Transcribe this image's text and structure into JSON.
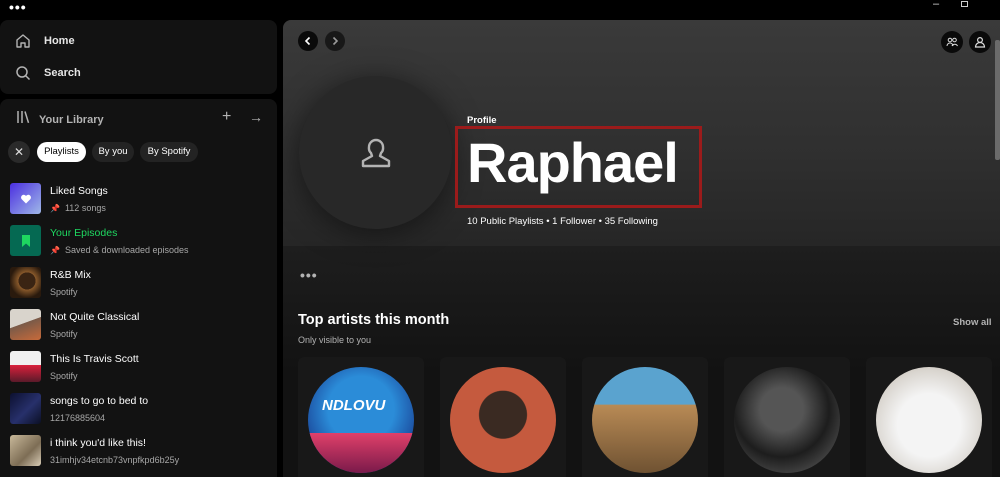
{
  "titlebar": {
    "menu": "•••",
    "minimize": "–"
  },
  "nav": {
    "home": "Home",
    "search": "Search"
  },
  "library": {
    "title": "Your Library",
    "add": "+",
    "expand": "→",
    "clear_filter": "✕",
    "chips": [
      "Playlists",
      "By you",
      "By Spotify"
    ],
    "items": [
      {
        "title": "Liked Songs",
        "sub": "112 songs",
        "pinned": true,
        "green": false,
        "icon": "heart-icon"
      },
      {
        "title": "Your Episodes",
        "sub": "Saved & downloaded episodes",
        "pinned": true,
        "green": true,
        "icon": "bookmark-icon"
      },
      {
        "title": "R&B Mix",
        "sub": "Spotify",
        "pinned": false,
        "green": false
      },
      {
        "title": "Not Quite Classical",
        "sub": "Spotify",
        "pinned": false,
        "green": false
      },
      {
        "title": "This Is Travis Scott",
        "sub": "Spotify",
        "pinned": false,
        "green": false
      },
      {
        "title": "songs to go to bed to",
        "sub": "12176885604",
        "pinned": false,
        "green": false
      },
      {
        "title": "i think you'd like this!",
        "sub": "31imhjv34etcnb73vnpfkpd6b25y",
        "pinned": false,
        "green": false
      }
    ]
  },
  "profile": {
    "label": "Profile",
    "name": "Raphael",
    "meta": "10 Public Playlists • 1 Follower • 35 Following"
  },
  "top_artists": {
    "more": "•••",
    "title": "Top artists this month",
    "subtitle": "Only visible to you",
    "show_all": "Show all",
    "first_card_text": "NDLOVU"
  },
  "colors": {
    "accent": "#1ed760",
    "highlight_box": "#9b1b1b"
  }
}
